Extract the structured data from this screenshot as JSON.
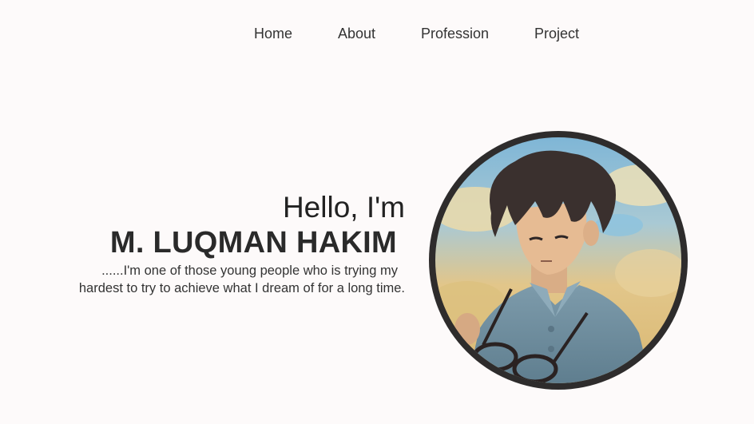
{
  "nav": {
    "items": [
      {
        "label": "Home"
      },
      {
        "label": "About"
      },
      {
        "label": "Profession"
      },
      {
        "label": "Project"
      }
    ]
  },
  "hero": {
    "greeting": "Hello, I'm",
    "name": "M. LUQMAN HAKIM",
    "bio_line_1": "......I'm one of those young people who is trying my",
    "bio_line_2": "hardest to try to achieve what I dream of for a long time."
  },
  "avatar": {
    "icon": "profile-illustration",
    "border_color": "#2e2c2c"
  },
  "colors": {
    "background": "#fdfafa",
    "text": "#222222"
  }
}
